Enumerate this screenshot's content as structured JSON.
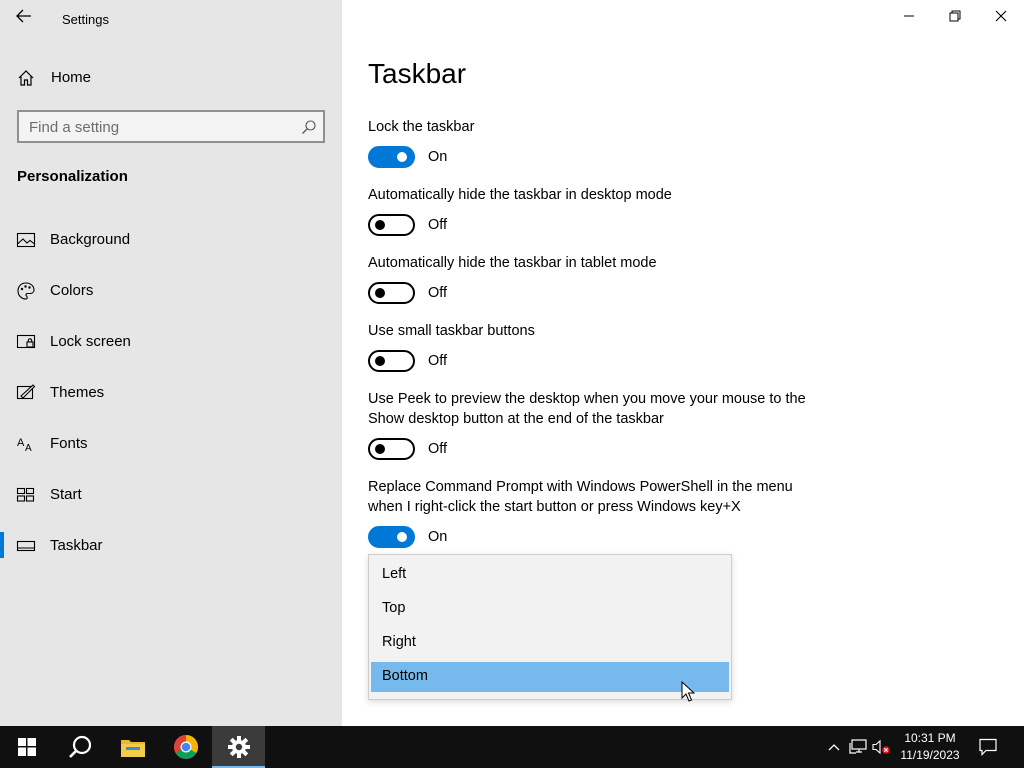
{
  "window": {
    "app_title": "Settings",
    "controls": [
      "minimize-icon",
      "restore-icon",
      "close-icon"
    ]
  },
  "sidebar": {
    "home_label": "Home",
    "search_placeholder": "Find a setting",
    "section_title": "Personalization",
    "items": [
      {
        "label": "Background",
        "icon": "picture-icon"
      },
      {
        "label": "Colors",
        "icon": "palette-icon"
      },
      {
        "label": "Lock screen",
        "icon": "lock-screen-icon"
      },
      {
        "label": "Themes",
        "icon": "themes-icon"
      },
      {
        "label": "Fonts",
        "icon": "fonts-icon"
      },
      {
        "label": "Start",
        "icon": "start-icon"
      },
      {
        "label": "Taskbar",
        "icon": "taskbar-icon",
        "selected": true
      }
    ]
  },
  "main": {
    "title": "Taskbar",
    "settings": [
      {
        "label": "Lock the taskbar",
        "state": "On"
      },
      {
        "label": "Automatically hide the taskbar in desktop mode",
        "state": "Off"
      },
      {
        "label": "Automatically hide the taskbar in tablet mode",
        "state": "Off"
      },
      {
        "label": "Use small taskbar buttons",
        "state": "Off"
      },
      {
        "label_line1": "Use Peek to preview the desktop when you move your mouse to the",
        "label_line2": "Show desktop button at the end of the taskbar",
        "state": "Off"
      },
      {
        "label_line1": "Replace Command Prompt with Windows PowerShell in the menu",
        "label_line2": "when I right-click the start button or press Windows key+X",
        "state": "On"
      }
    ],
    "dropdown_options": [
      "Left",
      "Top",
      "Right",
      "Bottom"
    ],
    "dropdown_selected": "Bottom"
  },
  "taskbar": {
    "time": "10:31 PM",
    "date": "11/19/2023",
    "apps": [
      "windows-start-icon",
      "search-icon",
      "file-explorer-icon",
      "chrome-icon",
      "settings-gear-icon"
    ]
  },
  "colors": {
    "accent": "#0078d7",
    "dropdown_selected": "#76b9ed",
    "sidebar_bg": "#e6e6e6",
    "taskbar_bg": "#101010"
  }
}
